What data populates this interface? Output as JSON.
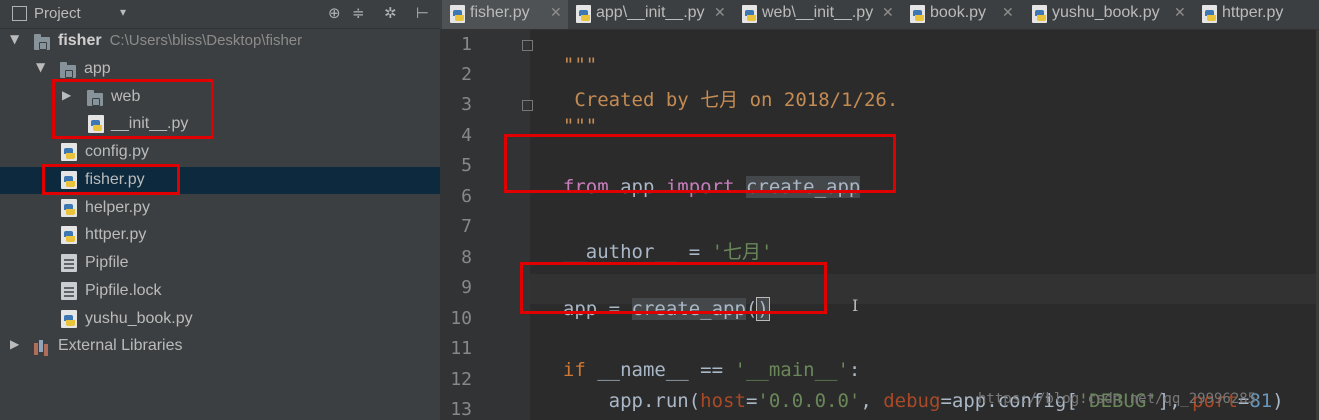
{
  "project_panel": {
    "title": "Project",
    "caret": "▾",
    "toolbar_icons": [
      "target-icon",
      "collapse-icon",
      "gear-icon",
      "hide-icon"
    ],
    "tree": {
      "root_name": "fisher",
      "root_path": "C:\\Users\\bliss\\Desktop\\fisher",
      "app_folder": "app",
      "web_folder": "web",
      "app_init": "__init__.py",
      "config": "config.py",
      "fisher": "fisher.py",
      "helper": "helper.py",
      "httper": "httper.py",
      "pipfile": "Pipfile",
      "pipfile_lock": "Pipfile.lock",
      "yushu_book": "yushu_book.py",
      "external_libraries": "External Libraries"
    }
  },
  "tabs": [
    {
      "label": "fisher.py",
      "active": true
    },
    {
      "label": "app\\__init__.py",
      "active": false
    },
    {
      "label": "web\\__init__.py",
      "active": false
    },
    {
      "label": "book.py",
      "active": false
    },
    {
      "label": "yushu_book.py",
      "active": false
    },
    {
      "label": "httper.py",
      "active": false
    }
  ],
  "editor": {
    "line_numbers": [
      "1",
      "2",
      "3",
      "4",
      "5",
      "6",
      "7",
      "8",
      "9",
      "10",
      "11",
      "12",
      "13"
    ],
    "code": {
      "docstring_open": "\"\"\"",
      "docstring_text": " Created by 七月 on 2018/1/26.",
      "docstring_close": "\"\"\"",
      "l5_from": "from",
      "l5_module": " app ",
      "l5_import": "import",
      "l5_space": " ",
      "l5_name": "create_app",
      "l7_author": "__author__",
      "l7_eq": " = ",
      "l7_value": "'七月'",
      "l9_var": "app = ",
      "l9_func": "create_app",
      "l9_open": "(",
      "l9_close": ")",
      "l11_if": "if",
      "l11_mid": " __name__ == ",
      "l11_main": "'__main__'",
      "l11_colon": ":",
      "l12_indent": "    app.run(",
      "l12_host_kw": "host",
      "l12_eq1": "=",
      "l12_host_val": "'0.0.0.0'",
      "l12_comma1": ", ",
      "l12_debug_kw": "debug",
      "l12_mid": "=app.config[",
      "l12_debug_val": "'DEBUG'",
      "l12_close": "], ",
      "l12_port_kw": "port",
      "l12_eq2": "=",
      "l12_port_val": "81",
      "l12_end": ")"
    }
  },
  "watermark": "https://blog.csdn.net/qq_29996285",
  "colors": {
    "highlight_box": "#E00000",
    "selection_row": "#0D293E",
    "editor_bg": "#2B2B2B",
    "panel_bg": "#3C3F41"
  }
}
